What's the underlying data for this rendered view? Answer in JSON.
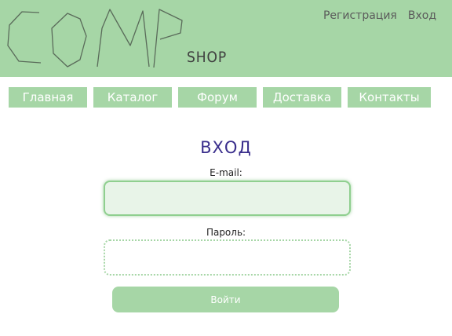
{
  "header": {
    "logo_main": "COMP",
    "logo_sub": "SHOP",
    "links": [
      "Регистрация",
      "Вход"
    ]
  },
  "nav": {
    "items": [
      "Главная",
      "Каталог",
      "Форум",
      "Доставка",
      "Контакты"
    ]
  },
  "login_form": {
    "title": "ВХОД",
    "email_label": "E-mail:",
    "email_value": "",
    "password_label": "Пароль:",
    "password_value": "",
    "submit_label": "Войти"
  },
  "colors": {
    "brand_green": "#a6d6a6",
    "title_purple": "#3a2e8c"
  }
}
